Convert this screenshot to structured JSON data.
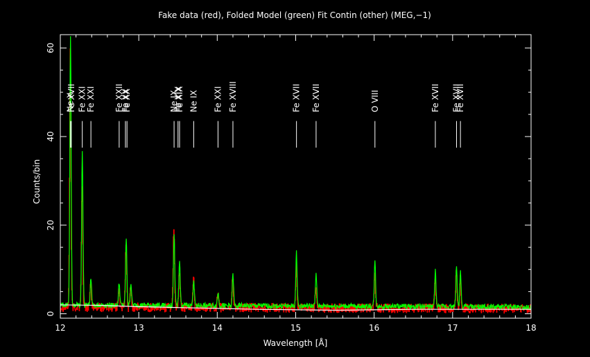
{
  "chart_data": {
    "type": "line",
    "title": "Fake data (red), Folded Model (green) Fit Contin (other) (MEG,−1)",
    "xlabel": "Wavelength [Å]",
    "ylabel": "Counts/bin",
    "xlim": [
      12,
      18
    ],
    "ylim": [
      -1,
      63
    ],
    "x_ticks": [
      "12",
      "13",
      "14",
      "15",
      "16",
      "17",
      "18"
    ],
    "y_ticks": [
      "0",
      "20",
      "40",
      "60"
    ],
    "colors": {
      "data": "#ff0000",
      "model": "#00ff00",
      "continuum": "#ffffff",
      "axes": "#ffffff",
      "labels": "#ffffff"
    },
    "line_ids": [
      {
        "label": "Ne X",
        "wavelength": 12.13
      },
      {
        "label": "Fe XVII",
        "wavelength": 12.14
      },
      {
        "label": "Fe XXI",
        "wavelength": 12.28
      },
      {
        "label": "Fe XXI",
        "wavelength": 12.39
      },
      {
        "label": "Fe XXII",
        "wavelength": 12.75
      },
      {
        "label": "Fe XX",
        "wavelength": 12.83
      },
      {
        "label": "Fe XX",
        "wavelength": 12.85
      },
      {
        "label": "Ne IX",
        "wavelength": 13.45
      },
      {
        "label": "Fe XIX",
        "wavelength": 13.5
      },
      {
        "label": "Fe XIX",
        "wavelength": 13.52
      },
      {
        "label": "Ne IX",
        "wavelength": 13.7
      },
      {
        "label": "Fe XXI",
        "wavelength": 14.01
      },
      {
        "label": "Fe XVIII",
        "wavelength": 14.2
      },
      {
        "label": "Fe XVII",
        "wavelength": 15.01
      },
      {
        "label": "Fe XVII",
        "wavelength": 15.26
      },
      {
        "label": "O VIII",
        "wavelength": 16.01
      },
      {
        "label": "Fe XVII",
        "wavelength": 16.78
      },
      {
        "label": "Fe XVII",
        "wavelength": 17.05
      },
      {
        "label": "Fe XVII",
        "wavelength": 17.1
      }
    ],
    "series": [
      {
        "role": "data",
        "color": "#ff0000",
        "baseline": 1.5,
        "noise": 1.0,
        "peaks": [
          [
            12.13,
            58
          ],
          [
            12.28,
            28
          ],
          [
            12.39,
            5
          ],
          [
            12.75,
            4
          ],
          [
            12.84,
            14
          ],
          [
            12.9,
            5
          ],
          [
            13.45,
            18
          ],
          [
            13.52,
            8
          ],
          [
            13.7,
            7
          ],
          [
            14.01,
            3
          ],
          [
            14.2,
            7
          ],
          [
            15.01,
            9
          ],
          [
            15.26,
            5
          ],
          [
            16.01,
            8
          ],
          [
            16.78,
            7
          ],
          [
            17.05,
            8
          ],
          [
            17.1,
            7
          ]
        ]
      },
      {
        "role": "model",
        "color": "#00ff00",
        "baseline": 2.0,
        "noise": 0.6,
        "peaks": [
          [
            12.13,
            61
          ],
          [
            12.28,
            35
          ],
          [
            12.39,
            6
          ],
          [
            12.75,
            5
          ],
          [
            12.84,
            15
          ],
          [
            12.9,
            5
          ],
          [
            13.45,
            16
          ],
          [
            13.52,
            10
          ],
          [
            13.7,
            6
          ],
          [
            14.01,
            3
          ],
          [
            14.2,
            7
          ],
          [
            15.01,
            12
          ],
          [
            15.26,
            7
          ],
          [
            16.01,
            10
          ],
          [
            16.78,
            8
          ],
          [
            17.05,
            9
          ],
          [
            17.1,
            8
          ]
        ]
      },
      {
        "role": "continuum",
        "color": "#ffffff",
        "x": [
          12.0,
          12.5,
          13.0,
          13.5,
          14.0,
          14.5,
          15.0,
          15.5,
          16.0,
          16.5,
          17.0,
          17.5,
          18.0
        ],
        "y": [
          2.0,
          1.9,
          1.6,
          1.4,
          1.2,
          1.0,
          0.9,
          0.8,
          0.9,
          1.0,
          1.0,
          1.0,
          1.0
        ]
      }
    ],
    "grid": false,
    "legend": "none"
  }
}
